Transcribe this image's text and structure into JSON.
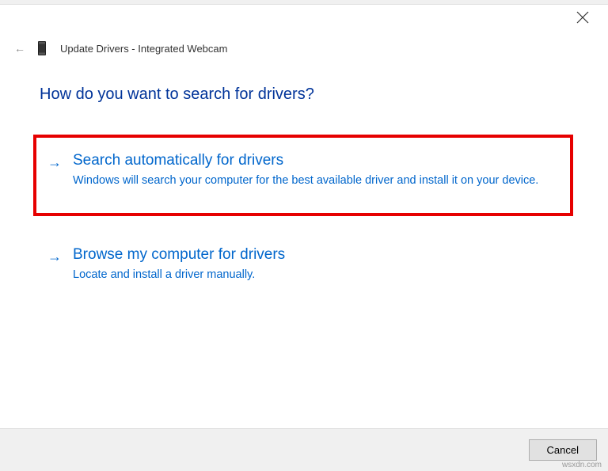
{
  "window": {
    "title_prefix": "Update Drivers -",
    "device_name": "Integrated Webcam"
  },
  "heading": "How do you want to search for drivers?",
  "options": [
    {
      "title": "Search automatically for drivers",
      "desc": "Windows will search your computer for the best available driver and install it on your device.",
      "highlighted": true
    },
    {
      "title": "Browse my computer for drivers",
      "desc": "Locate and install a driver manually.",
      "highlighted": false
    }
  ],
  "buttons": {
    "cancel": "Cancel"
  },
  "watermark": "wsxdn.com"
}
